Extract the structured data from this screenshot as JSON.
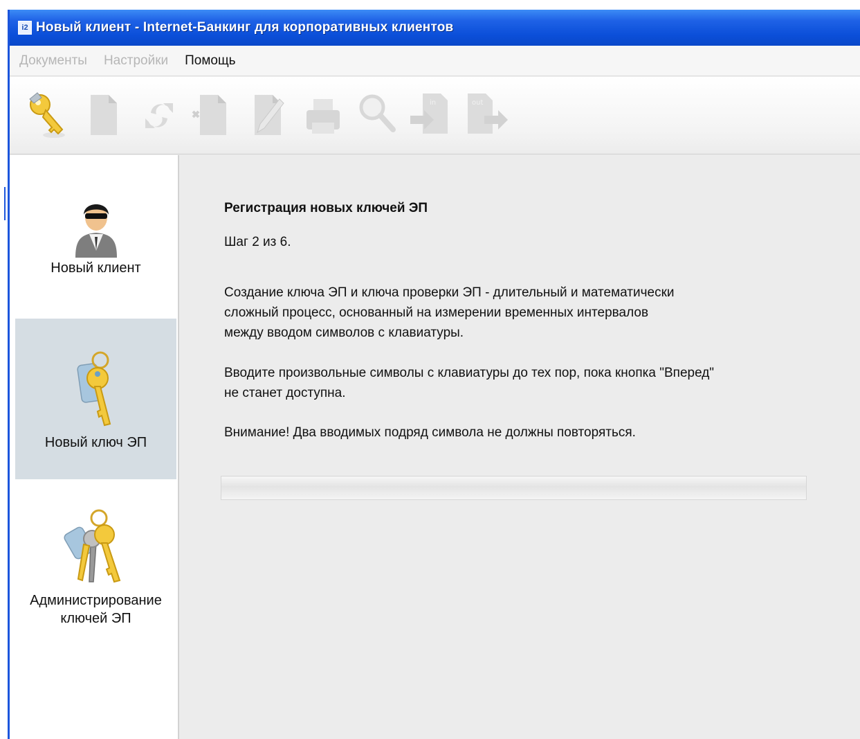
{
  "window": {
    "icon_text": "i2",
    "title": "Новый клиент - Internet-Банкинг для корпоративных клиентов"
  },
  "menu": [
    {
      "label": "Документы",
      "enabled": false
    },
    {
      "label": "Настройки",
      "enabled": false
    },
    {
      "label": "Помощь",
      "enabled": true
    }
  ],
  "toolbar": {
    "buttons": [
      {
        "icon": "key-icon",
        "enabled": true
      },
      {
        "icon": "new-document-icon",
        "enabled": false
      },
      {
        "icon": "refresh-icon",
        "enabled": false
      },
      {
        "icon": "delete-document-icon",
        "enabled": false
      },
      {
        "icon": "edit-document-icon",
        "enabled": false
      },
      {
        "icon": "printer-icon",
        "enabled": false
      },
      {
        "icon": "magnifier-icon",
        "enabled": false
      },
      {
        "icon": "import-icon",
        "label": "in",
        "enabled": false
      },
      {
        "icon": "export-icon",
        "label": "out",
        "enabled": false
      }
    ]
  },
  "sidebar": {
    "items": [
      {
        "label": "Новый клиент",
        "icon": "user-icon",
        "selected": false
      },
      {
        "label": "Новый ключ ЭП",
        "icon": "key-icon",
        "selected": true
      },
      {
        "label_line1": "Администрирование",
        "label_line2": "ключей ЭП",
        "icon": "keys-bunch-icon",
        "selected": false
      }
    ]
  },
  "content": {
    "heading": "Регистрация новых ключей ЭП",
    "step": "Шаг 2 из 6.",
    "paragraph1": [
      "Создание ключа ЭП и ключа проверки ЭП - длительный и математически",
      "сложный процесс, основанный на измерении временных интервалов",
      "между вводом символов с клавиатуры."
    ],
    "paragraph2": [
      "Вводите произвольные символы с клавиатуры до тех пор, пока кнопка \"Вперед\"",
      "не станет доступна."
    ],
    "warning": "Внимание! Два вводимых подряд символа не должны повторяться.",
    "progress": 0
  },
  "colors": {
    "titlebar": "#0b4fd9",
    "selected_nav": "#d5dde3",
    "key_gold": "#f3c93c",
    "disabled_icon": "#d9d9d9"
  }
}
